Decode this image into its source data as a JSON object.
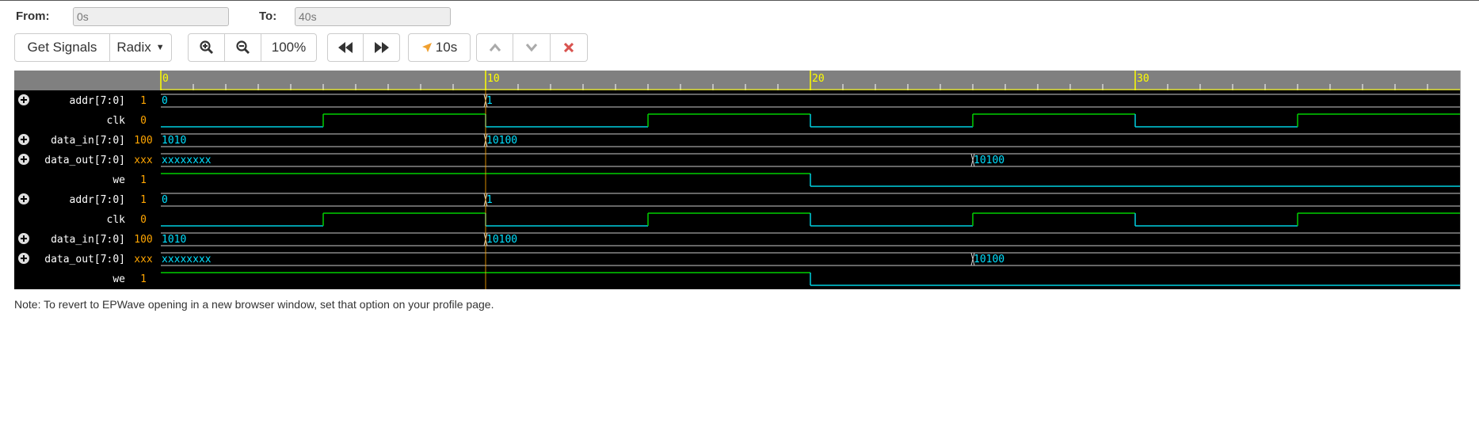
{
  "range": {
    "from_label": "From:",
    "from_value": "0s",
    "to_label": "To:",
    "to_value": "40s"
  },
  "toolbar": {
    "get_signals": "Get Signals",
    "radix": "Radix",
    "zoom_level": "100%",
    "cursor_time": "10s"
  },
  "timeline": {
    "ticks": [
      "0",
      "10",
      "20",
      "30"
    ],
    "time_range": [
      0,
      40
    ],
    "cursor_at": 10
  },
  "signals": [
    {
      "name": "addr[7:0]",
      "value": "1",
      "bus": true,
      "values": [
        {
          "t": 0,
          "v": "0"
        },
        {
          "t": 10,
          "v": "1"
        }
      ]
    },
    {
      "name": "clk",
      "value": "0",
      "bus": false,
      "edges": [
        {
          "t": 0,
          "v": 0
        },
        {
          "t": 5,
          "v": 1
        },
        {
          "t": 10,
          "v": 0
        },
        {
          "t": 15,
          "v": 1
        },
        {
          "t": 20,
          "v": 0
        },
        {
          "t": 25,
          "v": 1
        },
        {
          "t": 30,
          "v": 0
        },
        {
          "t": 35,
          "v": 1
        }
      ]
    },
    {
      "name": "data_in[7:0]",
      "value": "100",
      "bus": true,
      "values": [
        {
          "t": 0,
          "v": "1010"
        },
        {
          "t": 10,
          "v": "10100"
        }
      ]
    },
    {
      "name": "data_out[7:0]",
      "value": "xxx",
      "bus": true,
      "values": [
        {
          "t": 0,
          "v": "xxxxxxxx"
        },
        {
          "t": 25,
          "v": "10100"
        }
      ]
    },
    {
      "name": "we",
      "value": "1",
      "bus": false,
      "edges": [
        {
          "t": 0,
          "v": 1
        },
        {
          "t": 20,
          "v": 0
        }
      ]
    },
    {
      "name": "addr[7:0]",
      "value": "1",
      "bus": true,
      "values": [
        {
          "t": 0,
          "v": "0"
        },
        {
          "t": 10,
          "v": "1"
        }
      ]
    },
    {
      "name": "clk",
      "value": "0",
      "bus": false,
      "edges": [
        {
          "t": 0,
          "v": 0
        },
        {
          "t": 5,
          "v": 1
        },
        {
          "t": 10,
          "v": 0
        },
        {
          "t": 15,
          "v": 1
        },
        {
          "t": 20,
          "v": 0
        },
        {
          "t": 25,
          "v": 1
        },
        {
          "t": 30,
          "v": 0
        },
        {
          "t": 35,
          "v": 1
        }
      ]
    },
    {
      "name": "data_in[7:0]",
      "value": "100",
      "bus": true,
      "values": [
        {
          "t": 0,
          "v": "1010"
        },
        {
          "t": 10,
          "v": "10100"
        }
      ]
    },
    {
      "name": "data_out[7:0]",
      "value": "xxx",
      "bus": true,
      "values": [
        {
          "t": 0,
          "v": "xxxxxxxx"
        },
        {
          "t": 25,
          "v": "10100"
        }
      ]
    },
    {
      "name": "we",
      "value": "1",
      "bus": false,
      "edges": [
        {
          "t": 0,
          "v": 1
        },
        {
          "t": 20,
          "v": 0
        }
      ]
    }
  ],
  "colors": {
    "background": "#000000",
    "header": "#808080",
    "tick": "#ffff00",
    "clock_high": "#00d000",
    "signal_low": "#00d0e0",
    "bus_text": "#00e0ff",
    "value_text": "#ffa500",
    "cursor": "#ffa500"
  },
  "note": "Note: To revert to EPWave opening in a new browser window, set that option on your profile page."
}
